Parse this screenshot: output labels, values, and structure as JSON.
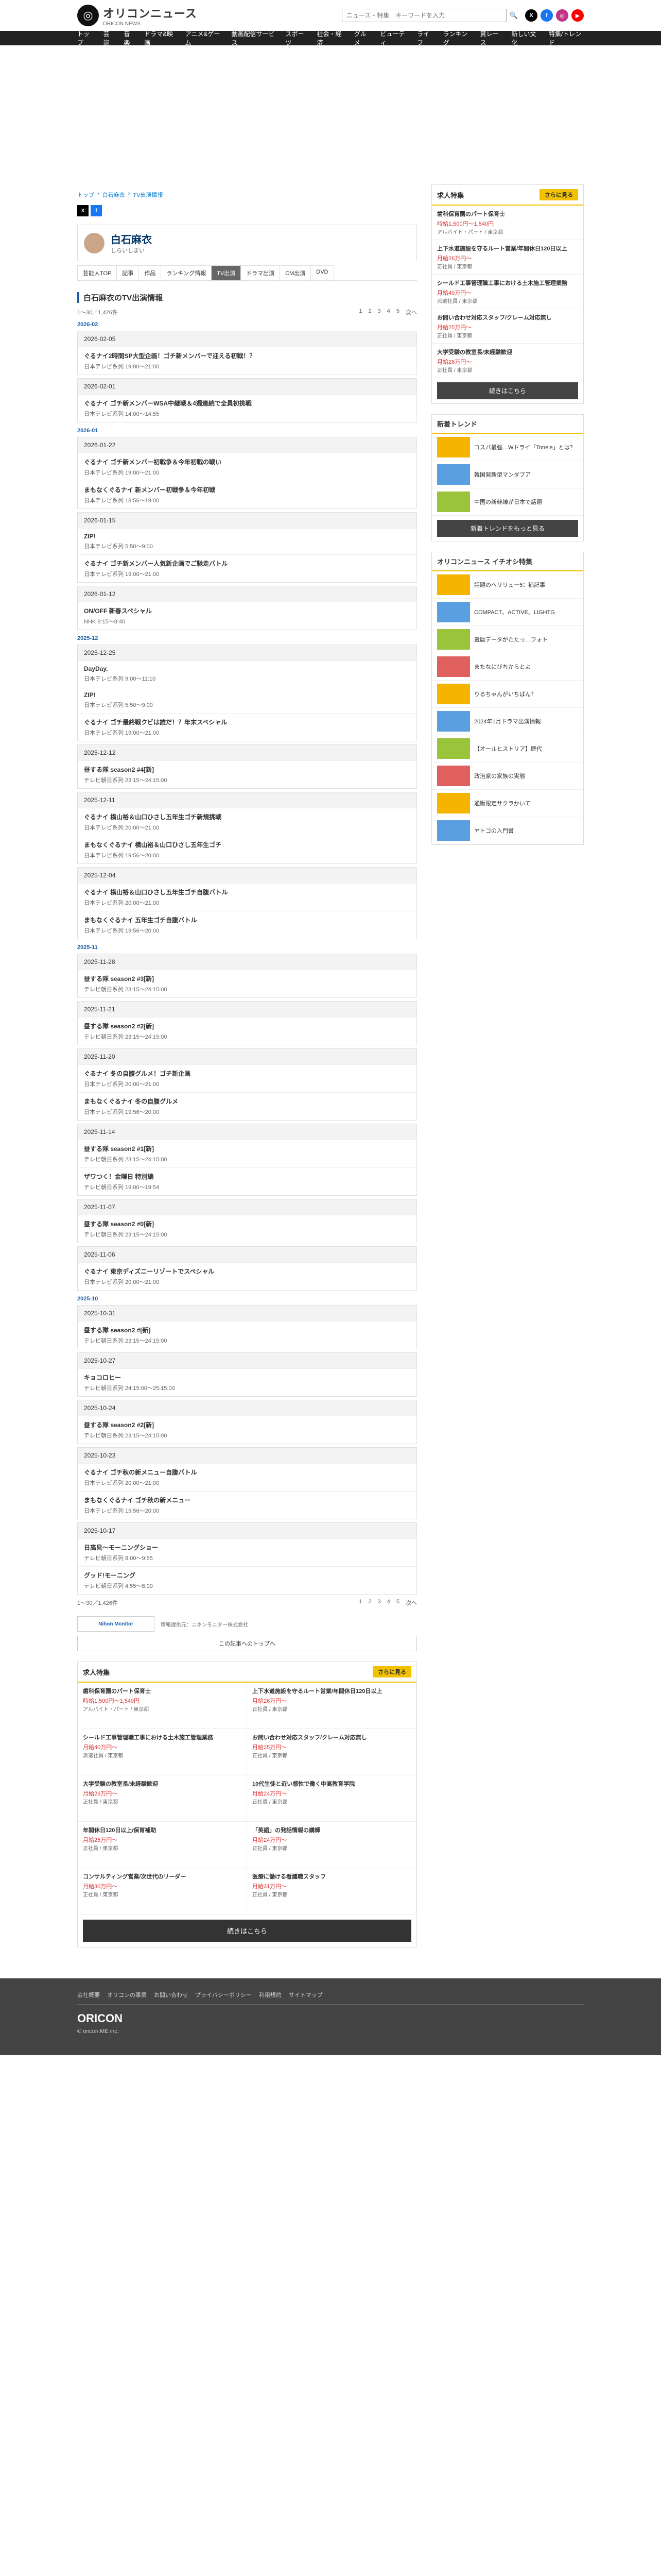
{
  "header": {
    "brand": "オリコンニュース",
    "brand_sub": "ORICON NEWS",
    "search_placeholder": "ニュース・特集　キーワードを入力",
    "nav": [
      "トップ",
      "芸能",
      "音楽",
      "ドラマ&映画",
      "アニメ&ゲーム",
      "動画配信サービス",
      "スポーツ",
      "社会・経済",
      "グルメ",
      "ビューティ",
      "ライフ",
      "ランキング",
      "賞レース",
      "新しい文化",
      "特集/トレンド"
    ]
  },
  "breadcrumb": [
    "トップ",
    "白石麻衣",
    "TV出演情報"
  ],
  "profile": {
    "name": "白石麻衣",
    "kana": "しらいしまい",
    "tabs": [
      "芸能人TOP",
      "記事",
      "作品",
      "ランキング情報",
      "TV出演",
      "ドラマ出演",
      "CM出演",
      "DVD"
    ]
  },
  "section_title": "白石麻衣のTV出演情報",
  "pager": {
    "count": "1〜30／1,426件",
    "links": [
      "1",
      "2",
      "3",
      "4",
      "5",
      "次へ"
    ],
    "bottom_count": "1〜30／1,426件"
  },
  "schedule": [
    {
      "month": "2026-02",
      "entries": [
        {
          "date": "2026-02-05",
          "progs": [
            {
              "t": "ぐるナイ2時間SP大型企画！ゴチ新メンバーで迎える初戦！？",
              "c": "日本テレビ系列 19:00〜21:00"
            }
          ]
        },
        {
          "date": "2026-02-01",
          "progs": [
            {
              "t": "ぐるナイ ゴチ新メンバーWSA中継戦＆4週連続で全員初挑戦",
              "c": "日本テレビ系列 14:00〜14:55"
            }
          ]
        }
      ]
    },
    {
      "month": "2026-01",
      "entries": [
        {
          "date": "2026-01-22",
          "progs": [
            {
              "t": "ぐるナイ ゴチ新メンバー初戦争＆今年初戦の戦い",
              "c": "日本テレビ系列 19:00〜21:00"
            },
            {
              "t": "まもなくぐるナイ 新メンバー初戦争＆今年初戦",
              "c": "日本テレビ系列 18:56〜19:00"
            }
          ]
        },
        {
          "date": "2026-01-15",
          "progs": [
            {
              "t": "ZIP!",
              "c": "日本テレビ系列 5:50〜9:00"
            },
            {
              "t": "ぐるナイ ゴチ新メンバー人気新企画でご馳走バトル",
              "c": "日本テレビ系列 19:00〜21:00"
            }
          ]
        },
        {
          "date": "2026-01-12",
          "progs": [
            {
              "t": "ON/OFF 新春スペシャル",
              "c": "NHK 8:15〜8:40"
            }
          ]
        }
      ]
    },
    {
      "month": "2025-12",
      "entries": [
        {
          "date": "2025-12-25",
          "progs": [
            {
              "t": "DayDay.",
              "c": "日本テレビ系列 9:00〜11:10"
            },
            {
              "t": "ZIP!",
              "c": "日本テレビ系列 5:50〜9:00"
            },
            {
              "t": "ぐるナイ ゴチ最終戦クビは誰だ！？年末スペシャル",
              "c": "日本テレビ系列 19:00〜21:00"
            }
          ]
        },
        {
          "date": "2025-12-12",
          "progs": [
            {
              "t": "昼する隊 season2 #4[新]",
              "c": "テレビ朝日系列 23:15〜24:15:00"
            }
          ]
        },
        {
          "date": "2025-12-11",
          "progs": [
            {
              "t": "ぐるナイ 横山裕＆山口ひさし五年生ゴチ新規挑戦",
              "c": "日本テレビ系列 20:00〜21:00"
            },
            {
              "t": "まもなくぐるナイ 横山裕＆山口ひさし五年生ゴチ",
              "c": "日本テレビ系列 19:56〜20:00"
            }
          ]
        },
        {
          "date": "2025-12-04",
          "progs": [
            {
              "t": "ぐるナイ 横山裕＆山口ひさし五年生ゴチ自腹バトル",
              "c": "日本テレビ系列 20:00〜21:00"
            },
            {
              "t": "まもなくぐるナイ 五年生ゴチ自腹バトル",
              "c": "日本テレビ系列 19:56〜20:00"
            }
          ]
        }
      ]
    },
    {
      "month": "2025-11",
      "entries": [
        {
          "date": "2025-11-28",
          "progs": [
            {
              "t": "昼する隊 season2 #3[新]",
              "c": "テレビ朝日系列 23:15〜24:15:00"
            }
          ]
        },
        {
          "date": "2025-11-21",
          "progs": [
            {
              "t": "昼する隊 season2 #2[新]",
              "c": "テレビ朝日系列 23:15〜24:15:00"
            }
          ]
        },
        {
          "date": "2025-11-20",
          "progs": [
            {
              "t": "ぐるナイ 冬の自腹グルメ！ゴチ新企画",
              "c": "日本テレビ系列 20:00〜21:00"
            },
            {
              "t": "まもなくぐるナイ 冬の自腹グルメ",
              "c": "日本テレビ系列 19:56〜20:00"
            }
          ]
        },
        {
          "date": "2025-11-14",
          "progs": [
            {
              "t": "昼する隊 season2 #1[新]",
              "c": "テレビ朝日系列 23:15〜24:15:00"
            },
            {
              "t": "ザワつく！金曜日 特別編",
              "c": "テレビ朝日系列 19:00〜19:54"
            }
          ]
        },
        {
          "date": "2025-11-07",
          "progs": [
            {
              "t": "昼する隊 season2 #0[新]",
              "c": "テレビ朝日系列 23:15〜24:15:00"
            }
          ]
        },
        {
          "date": "2025-11-06",
          "progs": [
            {
              "t": "ぐるナイ 東京ディズニーリゾートでスペシャル",
              "c": "日本テレビ系列 20:00〜21:00"
            }
          ]
        }
      ]
    },
    {
      "month": "2025-10",
      "entries": [
        {
          "date": "2025-10-31",
          "progs": [
            {
              "t": "昼する隊 season2 #[新]",
              "c": "テレビ朝日系列 23:15〜24:15:00"
            }
          ]
        },
        {
          "date": "2025-10-27",
          "progs": [
            {
              "t": "キョコロヒー",
              "c": "テレビ朝日系列 24:15:00〜25:15:00"
            }
          ]
        },
        {
          "date": "2025-10-24",
          "progs": [
            {
              "t": "昼する隊 season2 #2[新]",
              "c": "テレビ朝日系列 23:15〜24:15:00"
            }
          ]
        },
        {
          "date": "2025-10-23",
          "progs": [
            {
              "t": "ぐるナイ ゴチ秋の新メニュー自腹バトル",
              "c": "日本テレビ系列 20:00〜21:00"
            },
            {
              "t": "まもなくぐるナイ ゴチ秋の新メニュー",
              "c": "日本テレビ系列 19:56〜20:00"
            }
          ]
        },
        {
          "date": "2025-10-17",
          "progs": [
            {
              "t": "日高見〜モーニングショー",
              "c": "テレビ朝日系列 8:00〜9:55"
            },
            {
              "t": "グッド!モーニング",
              "c": "テレビ朝日系列 4:55〜8:00"
            }
          ]
        }
      ]
    }
  ],
  "nm": {
    "logo": "Nihon Monitor",
    "text": "情報提供元：ニホンモニター株式会社",
    "top_link": "この記事へのトップへ"
  },
  "side": {
    "jobs_title": "求人特集",
    "more": "さらに見る",
    "jobs": [
      {
        "t": "歯科保育園のパート保育士",
        "p": "時給1,500円〜1,540円",
        "l": "アルバイト・パート / 東京都"
      },
      {
        "t": "上下水道施設を守るルート営業/年間休日120日以上",
        "p": "月給26万円〜",
        "l": "正社員 / 東京都"
      },
      {
        "t": "シールド工事管理職工事における土木施工管理業務",
        "p": "月給40万円〜",
        "l": "派遣社員 / 東京都"
      },
      {
        "t": "お問い合わせ対応スタッフ/クレーム対応無し",
        "p": "月給25万円〜",
        "l": "正社員 / 東京都"
      },
      {
        "t": "大学受験の教室長/未経験歓迎",
        "p": "月給26万円〜",
        "l": "正社員 / 東京都"
      }
    ],
    "jobs_btn": "続きはこちら",
    "trend_title": "新着トレンド",
    "trends": [
      "コスパ最強…Wドライ「Tonele」とは？",
      "韓国発新型マンダプア",
      "中国の新幹線が日本で話題"
    ],
    "trend_btn": "新着トレンドをもっと見る",
    "recommend_title": "オリコンニュース イチオシ特集",
    "recommends": [
      "話題のペリリュー5：補記事",
      "COMPACT、ACTIVE、LIGHTG",
      "還暦データがたたっ…フォト",
      "またなにびちからとよ",
      "りるちゃんがいちばん？",
      "2024年1月ドラマ出演情報",
      "【オールヒストリア】歴代",
      "政治家の家族の実態",
      "通販限定サクラかいて",
      "ヤトコの入門書"
    ]
  },
  "footer_jobs": {
    "title": "求人特集",
    "more": "さらに見る",
    "jobs": [
      {
        "t": "歯科保育園のパート保育士",
        "p": "時給1,500円〜1,540円",
        "l": "アルバイト・パート / 東京都"
      },
      {
        "t": "上下水道施設を守るルート営業/年間休日120日以上",
        "p": "月給26万円〜",
        "l": "正社員 / 東京都"
      },
      {
        "t": "シールド工事管理職工事における土木施工管理業務",
        "p": "月給40万円〜",
        "l": "派遣社員 / 東京都"
      },
      {
        "t": "お問い合わせ対応スタッフ/クレーム対応無し",
        "p": "月給25万円〜",
        "l": "正社員 / 東京都"
      },
      {
        "t": "大学受験の教室長/未経験歓迎",
        "p": "月給26万円〜",
        "l": "正社員 / 東京都"
      },
      {
        "t": "10代生徒と近い感性で働く中高教育学院",
        "p": "月給24万円〜",
        "l": "正社員 / 東京都"
      },
      {
        "t": "年間休日120日以上/保育補助",
        "p": "月給25万円〜",
        "l": "正社員 / 東京都"
      },
      {
        "t": "「英語」の発話情報の講師",
        "p": "月給24万円〜",
        "l": "正社員 / 東京都"
      },
      {
        "t": "コンサルティング営業/次世代のリーダー",
        "p": "月給30万円〜",
        "l": "正社員 / 東京都"
      },
      {
        "t": "医療に働ける看護職スタッフ",
        "p": "月給31万円〜",
        "l": "正社員 / 東京都"
      }
    ],
    "btn": "続きはこちら"
  },
  "footer": {
    "links": [
      "会社概要",
      "オリコンの事業",
      "お問い合わせ",
      "プライバシーポリシー",
      "利用規約",
      "サイトマップ"
    ],
    "brand": "ORICON",
    "copy": "© oricon ME inc."
  }
}
